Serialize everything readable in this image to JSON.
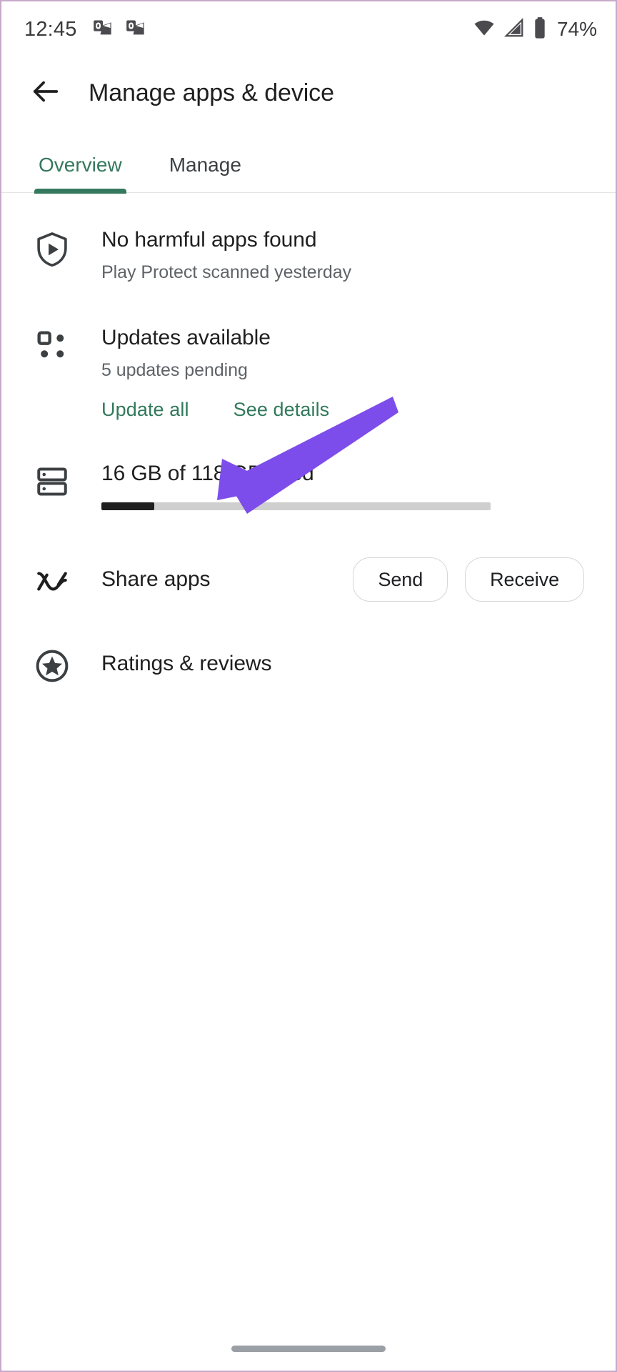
{
  "status_bar": {
    "time": "12:45",
    "battery_percent": "74%",
    "icons": [
      "outlook-notification-icon",
      "outlook-notification-icon",
      "wifi-icon",
      "cellular-signal-icon",
      "battery-icon"
    ]
  },
  "app_bar": {
    "back_icon": "arrow-left-icon",
    "title": "Manage apps & device"
  },
  "tabs": {
    "active_index": 0,
    "items": [
      {
        "label": "Overview",
        "active": true
      },
      {
        "label": "Manage",
        "active": false
      }
    ],
    "active_color": "#34785d"
  },
  "sections": {
    "play_protect": {
      "icon": "shield-play-icon",
      "title": "No harmful apps found",
      "subtitle": "Play Protect scanned yesterday"
    },
    "updates": {
      "icon": "apps-grid-icon",
      "title": "Updates available",
      "subtitle": "5 updates pending",
      "actions": [
        {
          "label": "Update all"
        },
        {
          "label": "See details"
        }
      ]
    },
    "storage": {
      "icon": "storage-icon",
      "title": "16 GB of 118 GB used",
      "used_gb": 16,
      "total_gb": 118,
      "fill_percent": 13.6,
      "fill_color": "#1f1f1f",
      "track_color": "#cfcfcf"
    },
    "share_apps": {
      "icon": "share-apps-icon",
      "title": "Share apps",
      "buttons": [
        {
          "label": "Send"
        },
        {
          "label": "Receive"
        }
      ]
    },
    "ratings": {
      "icon": "star-circle-icon",
      "title": "Ratings & reviews"
    }
  },
  "annotation": {
    "arrow_color": "#7c4dea",
    "name": "purple-pointer-arrow"
  },
  "gesture_bar": {
    "name": "home-gesture-bar"
  }
}
